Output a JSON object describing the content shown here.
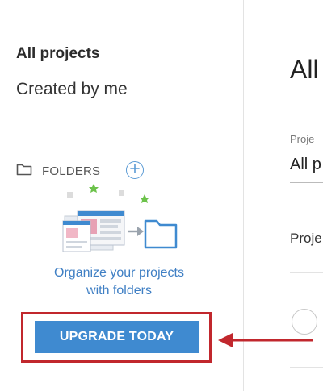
{
  "sidebar": {
    "nav": {
      "all_projects": "All projects",
      "created_by_me": "Created by me"
    },
    "folders": {
      "label": "FOLDERS",
      "empty_message_line1": "Organize your projects",
      "empty_message_line2": "with folders"
    },
    "upgrade_label": "UPGRADE TODAY"
  },
  "main": {
    "title": "All",
    "filter_label": "Proje",
    "filter_value": "All p",
    "column_header": "Proje"
  },
  "icons": {
    "folder": "folder-icon",
    "add_folder": "plus-circle-icon",
    "illustration": "projects-to-folder-illustration",
    "arrow": "left-arrow-annotation"
  },
  "colors": {
    "accent": "#3f8ad0",
    "link_text": "#3f7fc4",
    "highlight": "#c1272d",
    "star_green": "#6cc24a"
  }
}
